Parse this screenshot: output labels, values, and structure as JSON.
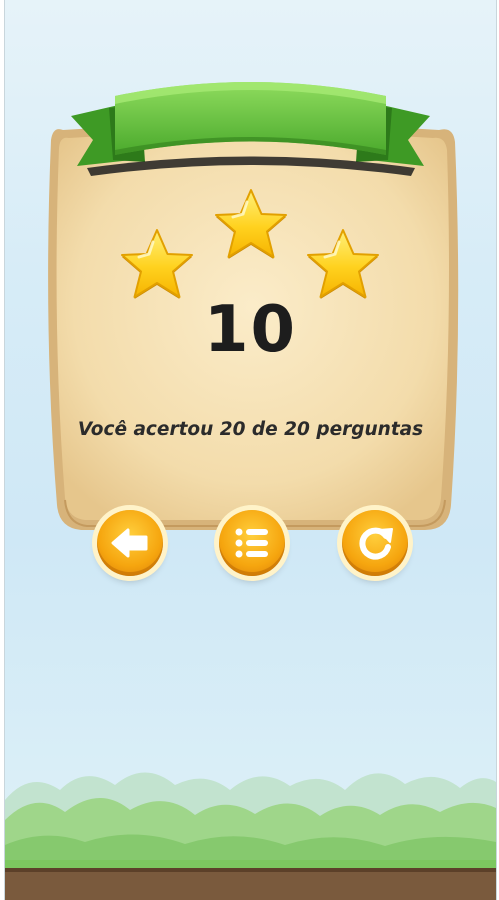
{
  "result_screen": {
    "stars_earned": 3,
    "stars_total": 3,
    "score": "10",
    "message": "Você acertou 20 de 20 perguntas"
  },
  "buttons": [
    {
      "name": "back-button",
      "icon": "arrow-left-icon"
    },
    {
      "name": "levels-menu-button",
      "icon": "list-icon"
    },
    {
      "name": "retry-button",
      "icon": "replay-icon"
    }
  ],
  "colors": {
    "panel": "#f5e2b8",
    "panel_border": "#d6b27a",
    "ribbon": "#6fc94a",
    "star": "#ffcc1a",
    "button": "#f6a60f"
  }
}
